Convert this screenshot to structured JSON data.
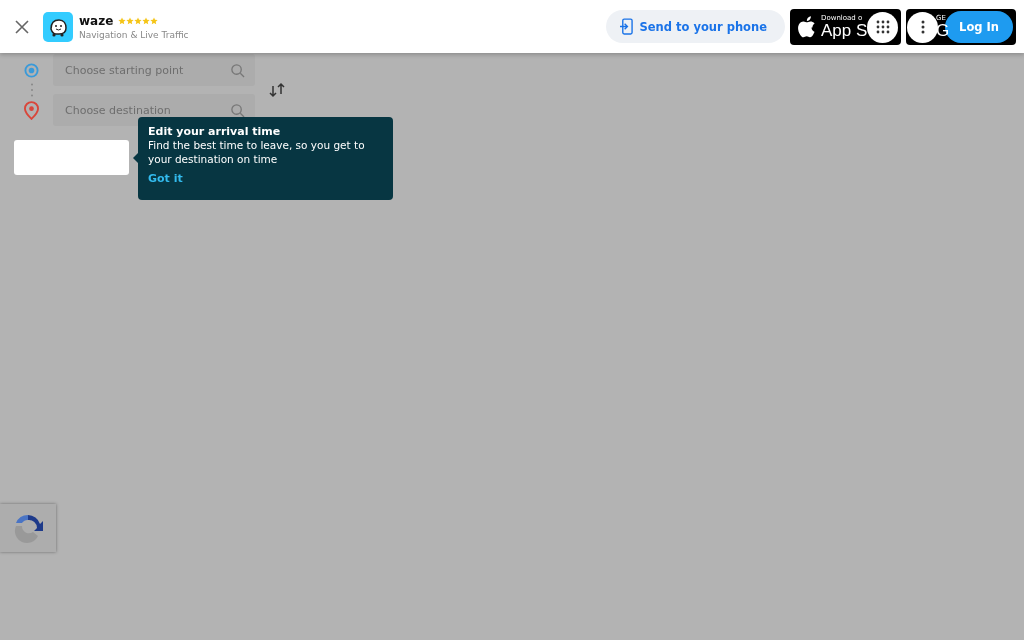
{
  "banner": {
    "app_name": "waze",
    "stars": 5,
    "subtitle": "Navigation & Live Traffic",
    "send_button": "Send to your phone",
    "app_store": {
      "small": "Download o",
      "big": "App S"
    },
    "play_store": {
      "small": "GE",
      "big": "G"
    },
    "login_button": "Log In"
  },
  "route": {
    "start": {
      "placeholder": "Choose starting point"
    },
    "destination": {
      "placeholder": "Choose destination"
    }
  },
  "tooltip": {
    "title": "Edit your arrival time",
    "body": "Find the best time to leave, so you get to your destination on time",
    "action": "Got it"
  }
}
